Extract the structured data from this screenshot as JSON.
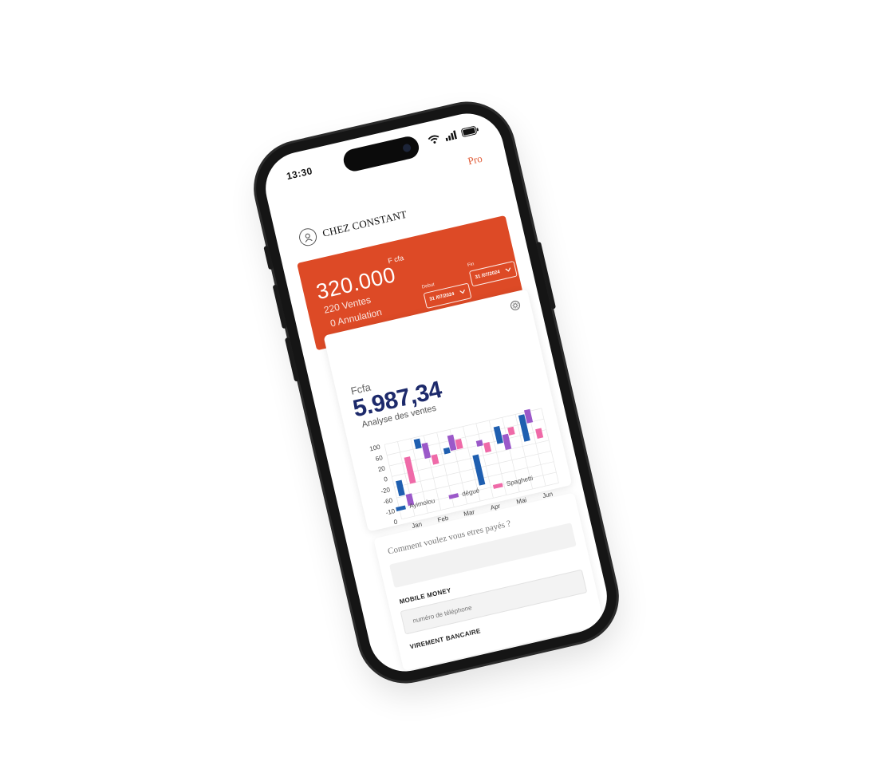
{
  "status_bar": {
    "time": "13:30"
  },
  "header": {
    "pro_label": "Pro",
    "shop_name": "CHEZ CONSTANT"
  },
  "sales": {
    "amount": "320.000",
    "currency": "F cfa",
    "ventes": "220 Ventes",
    "annulation": "0 Annulation",
    "debut_label": "Debut",
    "debut_date": "31 /07/2024",
    "fin_label": "Fin",
    "fin_date": "31 /07/2024"
  },
  "stats": {
    "currency_label": "Fcfa",
    "total": "5.987,34",
    "subtitle": "Analyse des ventes"
  },
  "chart_data": {
    "type": "bar",
    "categories": [
      "Jan",
      "Feb",
      "Mar",
      "Apr",
      "Mai",
      "Jun"
    ],
    "y_ticks": [
      "100",
      "60",
      "20",
      "0",
      "-20",
      "-60",
      "-10",
      "0"
    ],
    "ylim": [
      -100,
      100
    ],
    "grid": true,
    "legend_position": "bottom",
    "series": [
      {
        "name": "Ayimolou",
        "color": "#1f5fb0",
        "values": [
          [
            -40,
            0
          ],
          [
            70,
            95
          ],
          [
            40,
            55
          ],
          [
            -60,
            20
          ],
          [
            35,
            80
          ],
          [
            25,
            95
          ]
        ]
      },
      {
        "name": "dégué",
        "color": "#9b59c9",
        "values": [
          [
            -70,
            -40
          ],
          [
            40,
            80
          ],
          [
            45,
            85
          ],
          [
            40,
            55
          ],
          [
            15,
            55
          ],
          [
            70,
            105
          ]
        ]
      },
      {
        "name": "Spaghetti",
        "color": "#ef6aa8",
        "values": [
          [
            -15,
            55
          ],
          [
            20,
            45
          ],
          [
            45,
            70
          ],
          [
            20,
            45
          ],
          [
            50,
            70
          ],
          [
            25,
            50
          ]
        ]
      }
    ]
  },
  "payment": {
    "question": "Comment voulez vous etres payés ?",
    "mobile_money_label": "MOBILE MONEY",
    "phone_placeholder": "numéro de téléphone",
    "virement_label": "VIREMENT BANCAIRE"
  },
  "colors": {
    "accent": "#dd4a26",
    "value": "#1d2a6b"
  },
  "icons": [
    "wifi-icon",
    "signal-icon",
    "battery-icon",
    "avatar-icon",
    "chevron-down-icon",
    "settings-icon"
  ]
}
